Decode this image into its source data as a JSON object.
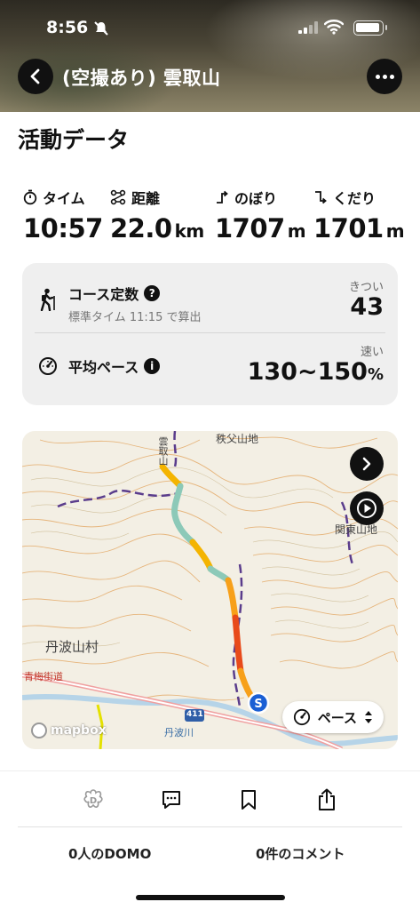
{
  "status_bar": {
    "time": "8:56"
  },
  "header": {
    "title": "(空撮あり) 雲取山"
  },
  "section": {
    "title": "活動データ"
  },
  "stats": [
    {
      "label": "タイム",
      "value": "10:57",
      "unit": "",
      "icon": "timer-icon"
    },
    {
      "label": "距離",
      "value": "22.0",
      "unit": "km",
      "icon": "route-icon"
    },
    {
      "label": "のぼり",
      "value": "1707",
      "unit": "m",
      "icon": "ascent-icon"
    },
    {
      "label": "くだり",
      "value": "1701",
      "unit": "m",
      "icon": "descent-icon"
    }
  ],
  "course": {
    "title": "コース定数",
    "subtitle": "標準タイム 11:15 で算出",
    "tag": "きつい",
    "value": "43"
  },
  "pace": {
    "title": "平均ペース",
    "tag": "速い",
    "value": "130~150",
    "unit": "%"
  },
  "map": {
    "labels": {
      "village": "丹波山村",
      "chichibu": "秩父山地",
      "kanto": "関東山地",
      "road": "青梅街道",
      "tabagawa": "丹波川",
      "route": "411",
      "top": "雲取山"
    },
    "attribution": "mapbox",
    "pace_selector": "ペース",
    "route_colors": [
      "#f4b400",
      "#8cc9b8",
      "#f7a01a",
      "#e84a1a"
    ]
  },
  "footer": {
    "domo_count": "0人のDOMO",
    "comment_count": "0件のコメント"
  }
}
